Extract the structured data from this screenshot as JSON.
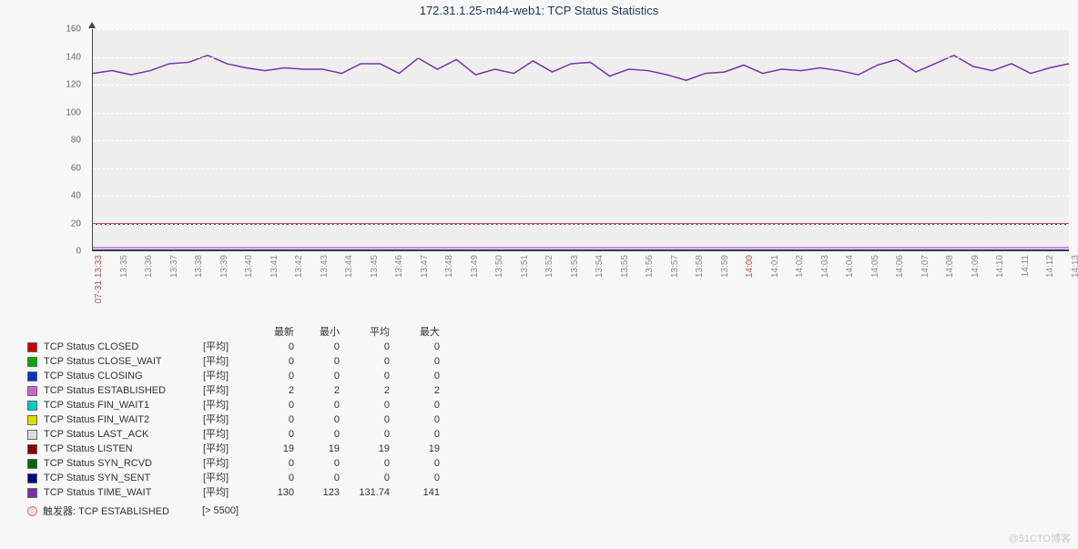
{
  "chart_data": {
    "type": "line",
    "title": "172.31.1.25-m44-web1: TCP Status Statistics",
    "ylabel": "",
    "xlabel": "",
    "ylim": [
      0,
      160
    ],
    "y_ticks": [
      0,
      20,
      40,
      60,
      80,
      100,
      120,
      140,
      160
    ],
    "x_labels": [
      "07-31 13:33",
      "13:35",
      "13:36",
      "13:37",
      "13:38",
      "13:39",
      "13:40",
      "13:41",
      "13:42",
      "13:43",
      "13:44",
      "13:45",
      "13:46",
      "13:47",
      "13:48",
      "13:49",
      "13:50",
      "13:51",
      "13:52",
      "13:53",
      "13:54",
      "13:55",
      "13:56",
      "13:57",
      "13:58",
      "13:59",
      "14:00",
      "14:01",
      "14:02",
      "14:03",
      "14:04",
      "14:05",
      "14:06",
      "14:07",
      "14:08",
      "14:09",
      "14:10",
      "14:11",
      "14:12",
      "14:13"
    ],
    "x_special": [
      "07-31 13:33",
      "14:00"
    ],
    "series": [
      {
        "name": "TCP Status CLOSED",
        "color": "#cc0000",
        "values": [
          0,
          0,
          0,
          0,
          0,
          0,
          0,
          0,
          0,
          0,
          0,
          0,
          0,
          0,
          0,
          0,
          0,
          0,
          0,
          0,
          0,
          0,
          0,
          0,
          0,
          0,
          0,
          0,
          0,
          0,
          0,
          0,
          0,
          0,
          0,
          0,
          0,
          0,
          0,
          0
        ]
      },
      {
        "name": "TCP Status CLOSE_WAIT",
        "color": "#00aa00",
        "values": [
          0,
          0,
          0,
          0,
          0,
          0,
          0,
          0,
          0,
          0,
          0,
          0,
          0,
          0,
          0,
          0,
          0,
          0,
          0,
          0,
          0,
          0,
          0,
          0,
          0,
          0,
          0,
          0,
          0,
          0,
          0,
          0,
          0,
          0,
          0,
          0,
          0,
          0,
          0,
          0
        ]
      },
      {
        "name": "TCP Status CLOSING",
        "color": "#0033cc",
        "values": [
          0,
          0,
          0,
          0,
          0,
          0,
          0,
          0,
          0,
          0,
          0,
          0,
          0,
          0,
          0,
          0,
          0,
          0,
          0,
          0,
          0,
          0,
          0,
          0,
          0,
          0,
          0,
          0,
          0,
          0,
          0,
          0,
          0,
          0,
          0,
          0,
          0,
          0,
          0,
          0
        ]
      },
      {
        "name": "TCP Status ESTABLISHED",
        "color": "#cc66cc",
        "values": [
          2,
          2,
          2,
          2,
          2,
          2,
          2,
          2,
          2,
          2,
          2,
          2,
          2,
          2,
          2,
          2,
          2,
          2,
          2,
          2,
          2,
          2,
          2,
          2,
          2,
          2,
          2,
          2,
          2,
          2,
          2,
          2,
          2,
          2,
          2,
          2,
          2,
          2,
          2,
          2
        ]
      },
      {
        "name": "TCP Status FIN_WAIT1",
        "color": "#00cccc",
        "values": [
          0,
          0,
          0,
          0,
          0,
          0,
          0,
          0,
          0,
          0,
          0,
          0,
          0,
          0,
          0,
          0,
          0,
          0,
          0,
          0,
          0,
          0,
          0,
          0,
          0,
          0,
          0,
          0,
          0,
          0,
          0,
          0,
          0,
          0,
          0,
          0,
          0,
          0,
          0,
          0
        ]
      },
      {
        "name": "TCP Status FIN_WAIT2",
        "color": "#dddd00",
        "values": [
          0,
          0,
          0,
          0,
          0,
          0,
          0,
          0,
          0,
          0,
          0,
          0,
          0,
          0,
          0,
          0,
          0,
          0,
          0,
          0,
          0,
          0,
          0,
          0,
          0,
          0,
          0,
          0,
          0,
          0,
          0,
          0,
          0,
          0,
          0,
          0,
          0,
          0,
          0,
          0
        ]
      },
      {
        "name": "TCP Status LAST_ACK",
        "color": "#dddddd",
        "values": [
          0,
          0,
          0,
          0,
          0,
          0,
          0,
          0,
          0,
          0,
          0,
          0,
          0,
          0,
          0,
          0,
          0,
          0,
          0,
          0,
          0,
          0,
          0,
          0,
          0,
          0,
          0,
          0,
          0,
          0,
          0,
          0,
          0,
          0,
          0,
          0,
          0,
          0,
          0,
          0
        ]
      },
      {
        "name": "TCP Status LISTEN",
        "color": "#880000",
        "values": [
          19,
          19,
          19,
          19,
          19,
          19,
          19,
          19,
          19,
          19,
          19,
          19,
          19,
          19,
          19,
          19,
          19,
          19,
          19,
          19,
          19,
          19,
          19,
          19,
          19,
          19,
          19,
          19,
          19,
          19,
          19,
          19,
          19,
          19,
          19,
          19,
          19,
          19,
          19,
          19
        ]
      },
      {
        "name": "TCP Status SYN_RCVD",
        "color": "#006600",
        "values": [
          0,
          0,
          0,
          0,
          0,
          0,
          0,
          0,
          0,
          0,
          0,
          0,
          0,
          0,
          0,
          0,
          0,
          0,
          0,
          0,
          0,
          0,
          0,
          0,
          0,
          0,
          0,
          0,
          0,
          0,
          0,
          0,
          0,
          0,
          0,
          0,
          0,
          0,
          0,
          0
        ]
      },
      {
        "name": "TCP Status SYN_SENT",
        "color": "#000088",
        "values": [
          0,
          0,
          0,
          0,
          0,
          0,
          0,
          0,
          0,
          0,
          0,
          0,
          0,
          0,
          0,
          0,
          0,
          0,
          0,
          0,
          0,
          0,
          0,
          0,
          0,
          0,
          0,
          0,
          0,
          0,
          0,
          0,
          0,
          0,
          0,
          0,
          0,
          0,
          0,
          0
        ]
      },
      {
        "name": "TCP Status TIME_WAIT",
        "color": "#7733aa",
        "values": [
          128,
          130,
          127,
          130,
          135,
          136,
          141,
          135,
          132,
          130,
          132,
          131,
          131,
          128,
          135,
          135,
          128,
          139,
          131,
          138,
          127,
          131,
          128,
          137,
          129,
          135,
          136,
          126,
          131,
          130,
          127,
          123,
          128,
          129,
          134,
          128,
          131,
          130,
          132,
          130,
          127,
          134,
          138,
          129,
          135,
          141,
          133,
          130,
          135,
          128,
          132,
          135
        ]
      }
    ]
  },
  "legend": {
    "headers": {
      "latest": "最新",
      "min": "最小",
      "avg": "平均",
      "max": "最大"
    },
    "aggregate_label": "[平均]",
    "rows": [
      {
        "color": "#cc0000",
        "name": "TCP Status CLOSED",
        "latest": "0",
        "min": "0",
        "avg": "0",
        "max": "0"
      },
      {
        "color": "#00aa00",
        "name": "TCP Status CLOSE_WAIT",
        "latest": "0",
        "min": "0",
        "avg": "0",
        "max": "0"
      },
      {
        "color": "#0033cc",
        "name": "TCP Status CLOSING",
        "latest": "0",
        "min": "0",
        "avg": "0",
        "max": "0"
      },
      {
        "color": "#cc66cc",
        "name": "TCP Status ESTABLISHED",
        "latest": "2",
        "min": "2",
        "avg": "2",
        "max": "2"
      },
      {
        "color": "#00cccc",
        "name": "TCP Status FIN_WAIT1",
        "latest": "0",
        "min": "0",
        "avg": "0",
        "max": "0"
      },
      {
        "color": "#dddd00",
        "name": "TCP Status FIN_WAIT2",
        "latest": "0",
        "min": "0",
        "avg": "0",
        "max": "0"
      },
      {
        "color": "#dddddd",
        "name": "TCP Status LAST_ACK",
        "latest": "0",
        "min": "0",
        "avg": "0",
        "max": "0"
      },
      {
        "color": "#880000",
        "name": "TCP Status LISTEN",
        "latest": "19",
        "min": "19",
        "avg": "19",
        "max": "19"
      },
      {
        "color": "#006600",
        "name": "TCP Status SYN_RCVD",
        "latest": "0",
        "min": "0",
        "avg": "0",
        "max": "0"
      },
      {
        "color": "#000088",
        "name": "TCP Status SYN_SENT",
        "latest": "0",
        "min": "0",
        "avg": "0",
        "max": "0"
      },
      {
        "color": "#7733aa",
        "name": "TCP Status TIME_WAIT",
        "latest": "130",
        "min": "123",
        "avg": "131.74",
        "max": "141"
      }
    ],
    "trigger": {
      "label": "触发器: TCP ESTABLISHED",
      "threshold": "[> 5500]"
    }
  },
  "watermark": "@51CTO博客"
}
